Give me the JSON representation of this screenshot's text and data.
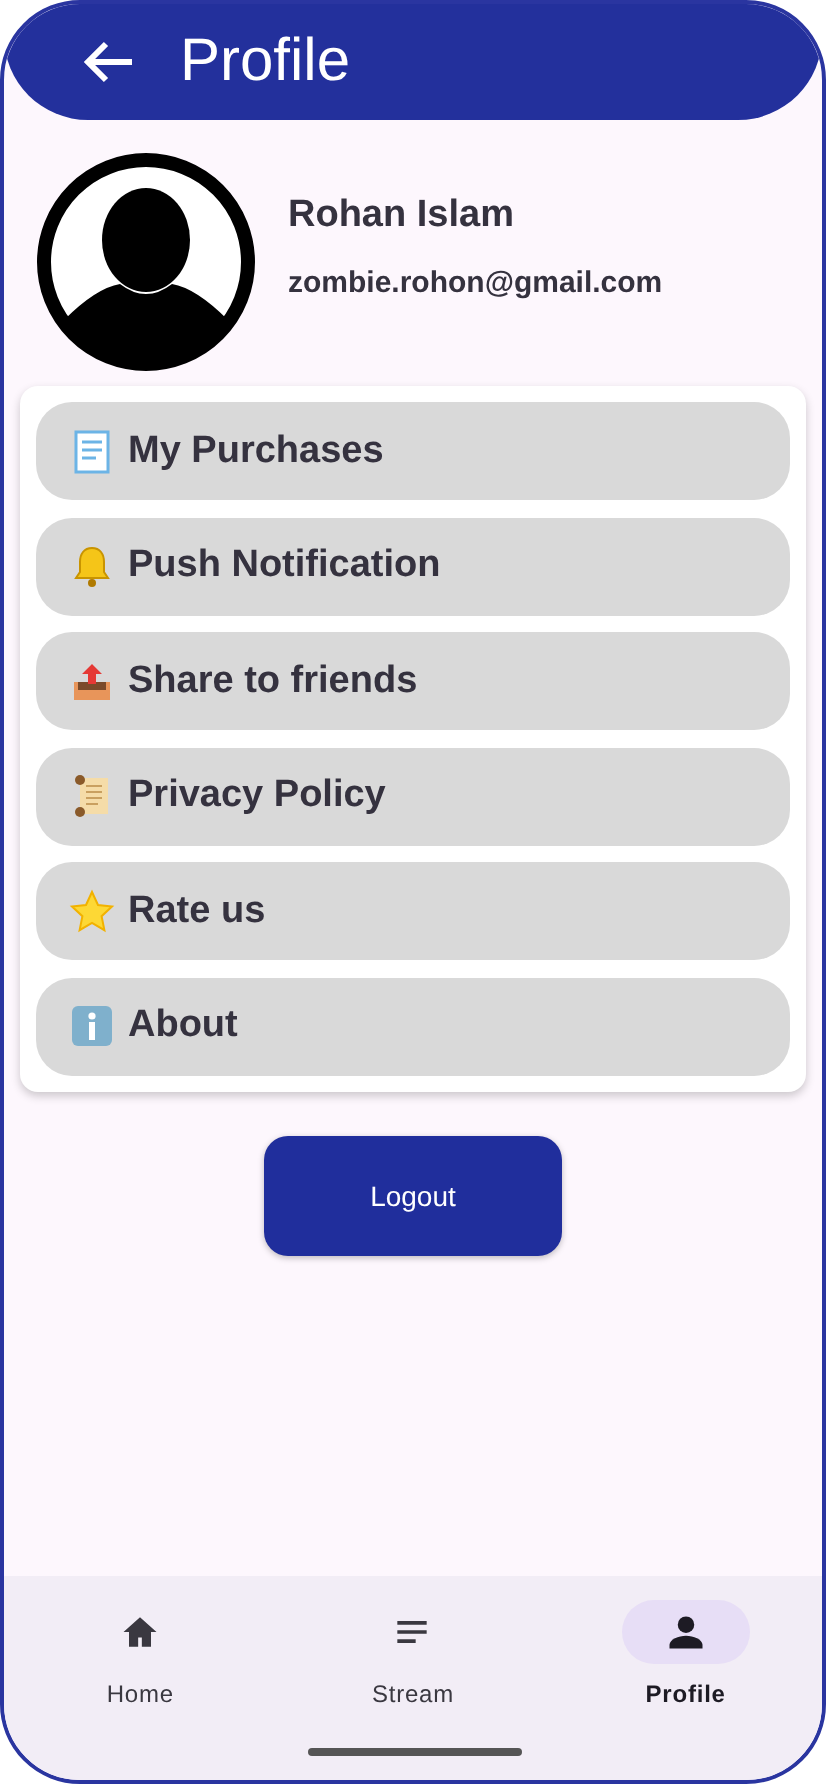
{
  "app_bar": {
    "title": "Profile"
  },
  "profile": {
    "name": "Rohan Islam",
    "email": "zombie.rohon@gmail.com"
  },
  "menu": [
    {
      "label": "My Purchases"
    },
    {
      "label": "Push Notification"
    },
    {
      "label": "Share to friends"
    },
    {
      "label": "Privacy Policy"
    },
    {
      "label": "Rate us"
    },
    {
      "label": "About"
    }
  ],
  "logout_button": {
    "label": "Logout"
  },
  "bottom_nav": [
    {
      "label": "Home",
      "selected": false
    },
    {
      "label": "Stream",
      "selected": false
    },
    {
      "label": "Profile",
      "selected": true
    }
  ]
}
